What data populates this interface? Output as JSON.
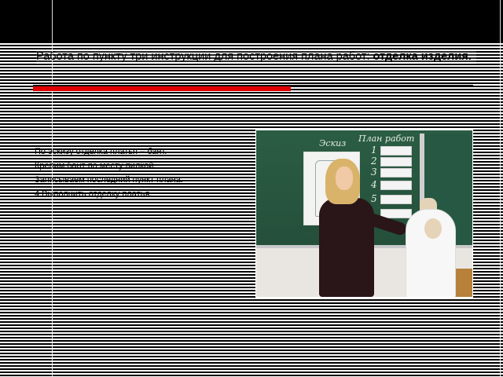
{
  "slide": {
    "title_regular": "Работа по пункту три инструкции для построения плана работ:",
    "title_bold": " отделка изделия.",
    "body_lines": [
      "По эскизу отделка платья – бант.",
      "Крепим бант по месту пилкой.",
      "Записываем последний пункт плана:",
      "4.Выполнить отделку платья."
    ]
  },
  "photo": {
    "board_left_text": "Эскиз",
    "board_right_text": "План работ",
    "plan_numbers": [
      "1",
      "2",
      "3",
      "4",
      "5"
    ]
  },
  "colors": {
    "background": "#000000",
    "stripe": "#ffffff",
    "accent_red": "#e00000",
    "chalkboard": "#2b5d44"
  }
}
